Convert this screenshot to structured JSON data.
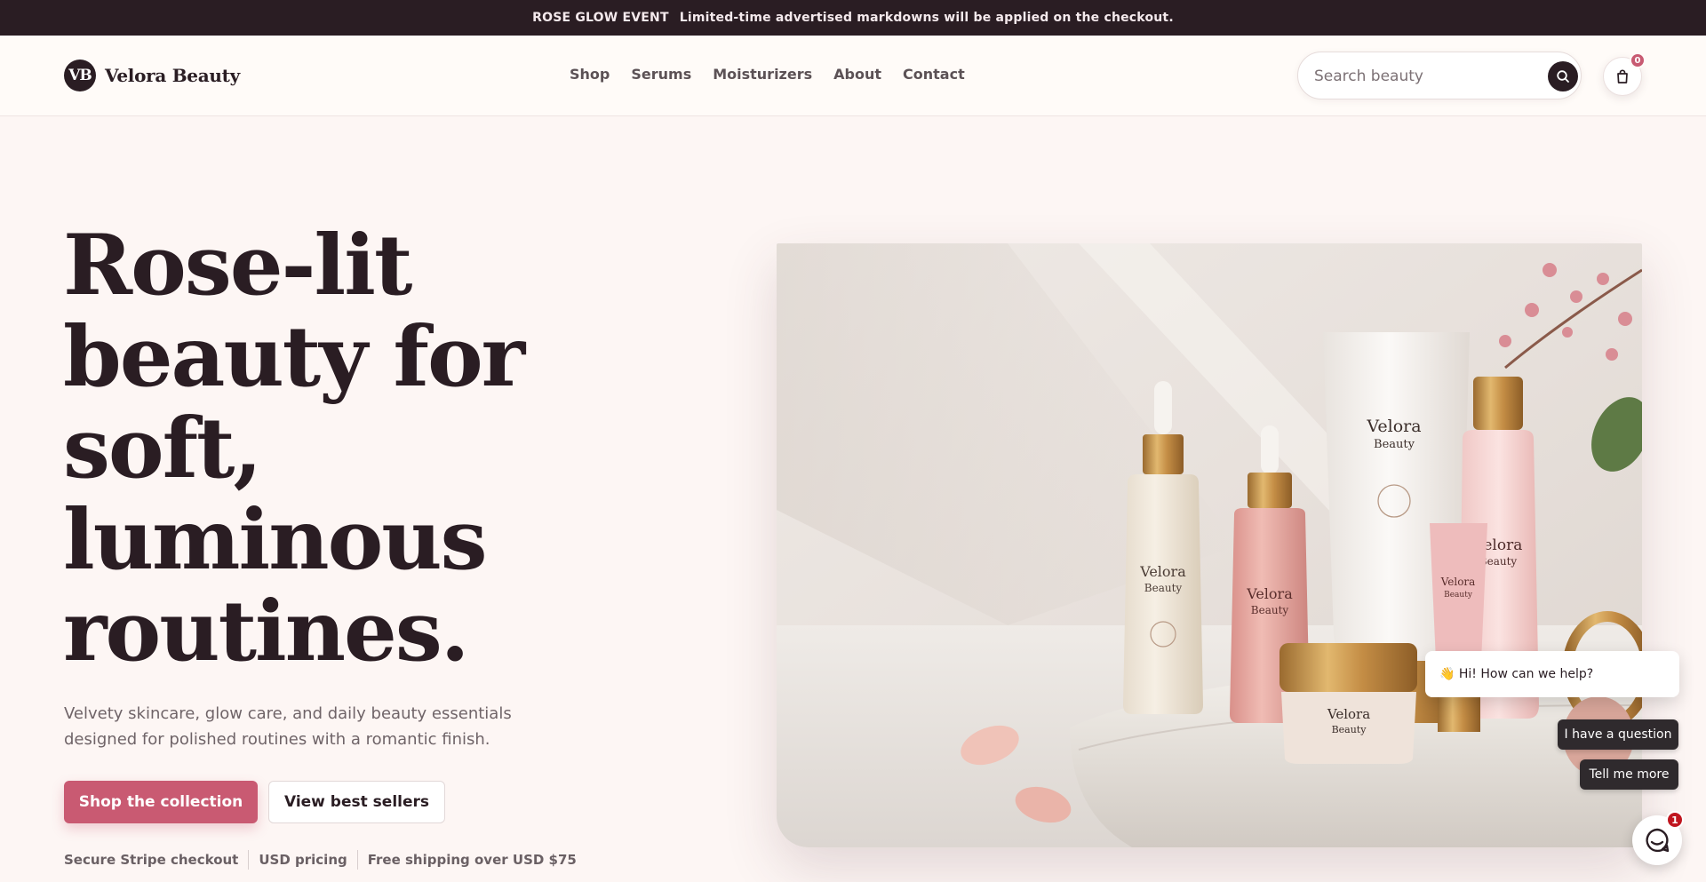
{
  "announcement": {
    "label": "ROSE GLOW EVENT",
    "text": "Limited-time advertised markdowns will be applied on the checkout."
  },
  "brand": {
    "initials": "VB",
    "name": "Velora Beauty"
  },
  "nav": {
    "items": [
      "Shop",
      "Serums",
      "Moisturizers",
      "About",
      "Contact"
    ]
  },
  "search": {
    "placeholder": "Search beauty",
    "value": ""
  },
  "cart": {
    "count": "0"
  },
  "hero": {
    "title": "Rose-lit beauty for soft, luminous routines.",
    "subtitle": "Velvety skincare, glow care, and daily beauty essentials designed for polished routines with a romantic finish.",
    "primary_cta": "Shop the collection",
    "secondary_cta": "View best sellers",
    "trust": [
      "Secure Stripe checkout",
      "USD pricing",
      "Free shipping over USD $75"
    ],
    "product_labels": {
      "brand_line1": "Velora",
      "brand_line2": "Beauty"
    }
  },
  "chat": {
    "greeting": "👋 Hi! How can we help?",
    "option_question": "I have a question",
    "option_more": "Tell me more",
    "unread": "1"
  },
  "colors": {
    "accent": "#c95a72",
    "dark": "#2a1d23",
    "background": "#fdf6f4"
  }
}
